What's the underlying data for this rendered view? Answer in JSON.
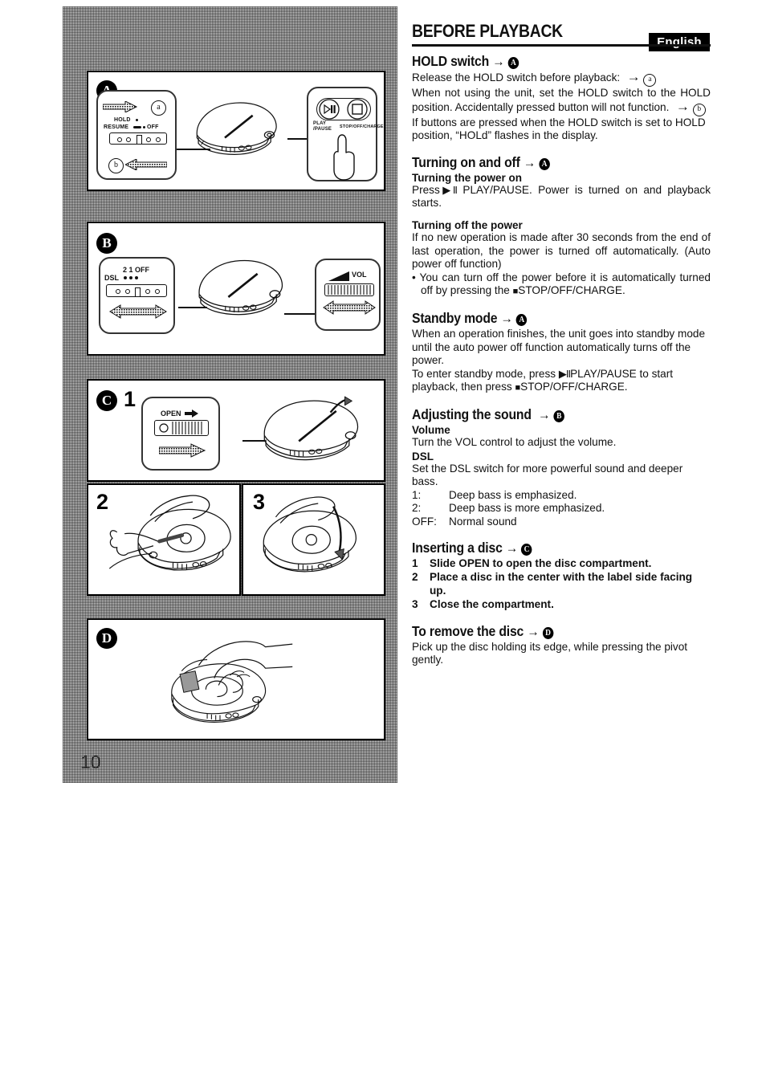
{
  "page": {
    "number": "10",
    "language_badge": "English",
    "title": "BEFORE PLAYBACK"
  },
  "sections": [
    {
      "id": "hold-switch",
      "heading": "HOLD switch",
      "ref": "A",
      "paragraphs": [
        "Release the HOLD switch before playback:",
        "When not using the unit, set the HOLD switch to the HOLD position. Accidentally pressed button will not function.",
        "If buttons are pressed when the HOLD switch is set to HOLD position, “HOLd” flashes in the display."
      ],
      "inline_refs": [
        "a",
        "b"
      ]
    },
    {
      "id": "turning-on-and-off",
      "heading": "Turning on and off",
      "ref": "A",
      "sub1_title": "Turning the power on",
      "sub1_text_pre": "Press",
      "sub1_glyph": "▶II",
      "sub1_text_post": " PLAY/PAUSE. Power is turned on and playback starts.",
      "sub2_title": "Turning off the power",
      "sub2_text": "If no new operation is made after 30 seconds from the end of last operation, the power is turned off automatically. (Auto power off function)",
      "bullet_pre": "• You can turn off the power before it is automatically turned off by pressing the ",
      "bullet_glyph": "■",
      "bullet_post": "STOP/OFF/CHARGE."
    },
    {
      "id": "standby-mode",
      "heading": "Standby mode",
      "ref": "A",
      "para1": "When an operation finishes, the unit goes into standby mode until the auto power off function automatically turns off the power.",
      "para2_pre": "To enter standby mode, press ",
      "para2_glyph1": "▶II",
      "para2_mid": "PLAY/PAUSE to start playback, then press ",
      "para2_glyph2": "■",
      "para2_post": "STOP/OFF/CHARGE."
    },
    {
      "id": "adjusting-the-sound",
      "heading": "Adjusting the sound",
      "ref": "B",
      "volume_title": "Volume",
      "volume_text": "Turn the VOL control to adjust the volume.",
      "dsl_title": "DSL",
      "dsl_text": "Set the DSL switch for more powerful sound and deeper bass.",
      "dsl_options": [
        {
          "key": "1:",
          "desc": "Deep bass is emphasized."
        },
        {
          "key": "2:",
          "desc": "Deep bass is more emphasized."
        },
        {
          "key": "OFF:",
          "desc": "Normal sound"
        }
      ]
    },
    {
      "id": "inserting-a-disc",
      "heading": "Inserting a disc",
      "ref": "C",
      "steps": [
        {
          "n": "1",
          "text": "Slide OPEN to open the disc compartment."
        },
        {
          "n": "2",
          "text": "Place a disc in the center with the label side facing up."
        },
        {
          "n": "3",
          "text": "Close the compartment."
        }
      ]
    },
    {
      "id": "to-remove-the-disc",
      "heading": "To remove the disc",
      "ref": "D",
      "text": "Pick up the disc holding its edge, while pressing the pivot gently."
    }
  ],
  "figures": {
    "panel_a": {
      "badge": "A",
      "ref_a": "a",
      "ref_b": "b",
      "switch_labels": {
        "hold": "HOLD",
        "resume": "RESUME",
        "off": "OFF"
      },
      "button_labels": {
        "play_pause_line1": "PLAY",
        "play_pause_line2": "/PAUSE",
        "stop": "STOP/OFF/CHARGE"
      }
    },
    "panel_b": {
      "badge": "B",
      "dsl_label": "DSL",
      "dsl_positions": "2 1 OFF",
      "vol_label": "VOL"
    },
    "panel_c1": {
      "badge": "C",
      "step": "1",
      "open_label": "OPEN"
    },
    "panel_c2": {
      "step": "2"
    },
    "panel_c3": {
      "step": "3"
    },
    "panel_d": {
      "badge": "D"
    }
  }
}
